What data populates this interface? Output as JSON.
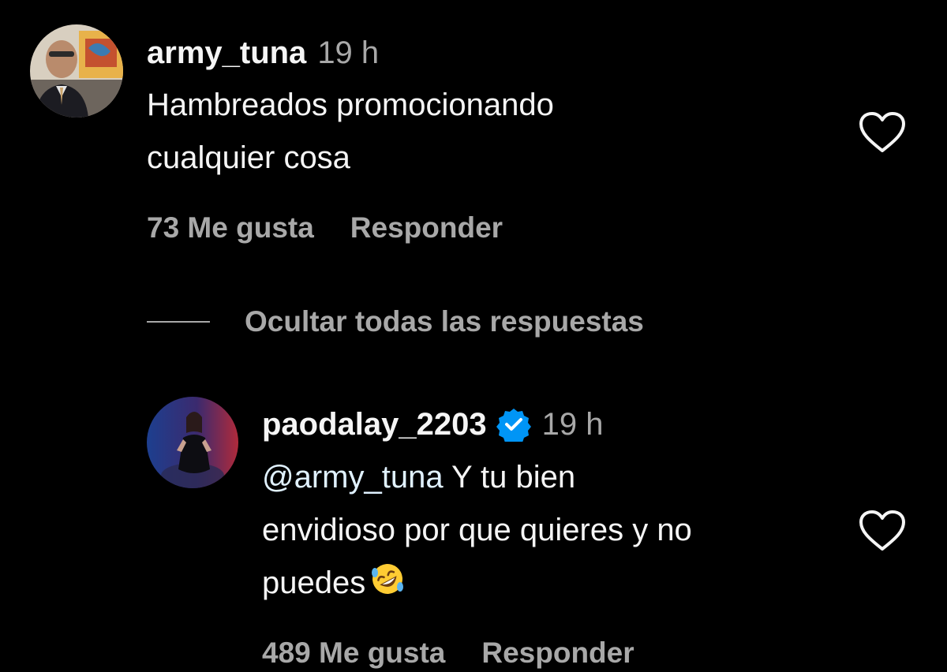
{
  "comments": [
    {
      "username": "army_tuna",
      "time": "19 h",
      "text_lines": [
        "Hambreados promocionando",
        "cualquier cosa"
      ],
      "likes": "73 Me gusta",
      "reply_label": "Responder",
      "avatar_icon": "avatar-man-in-suit",
      "like_icon": "heart-outline-icon"
    }
  ],
  "hide_replies_label": "Ocultar todas las respuestas",
  "replies": [
    {
      "username": "paodalay_2203",
      "verified": true,
      "verified_icon": "verified-badge-icon",
      "time": "19 h",
      "mention": "@army_tuna",
      "text_line1_rest": " Y tu bien",
      "text_line2": "envidioso por que quieres y no",
      "text_line3": "puedes",
      "emoji": "rolling-on-floor-laughing-emoji",
      "likes": "489 Me gusta",
      "reply_label": "Responder",
      "avatar_icon": "avatar-woman-dark-dress",
      "like_icon": "heart-outline-icon"
    }
  ],
  "colors": {
    "background": "#000000",
    "primary_text": "#f5f5f5",
    "secondary_text": "#a8a8a8",
    "mention": "#e0f1ff",
    "verified_blue": "#0095f6"
  }
}
